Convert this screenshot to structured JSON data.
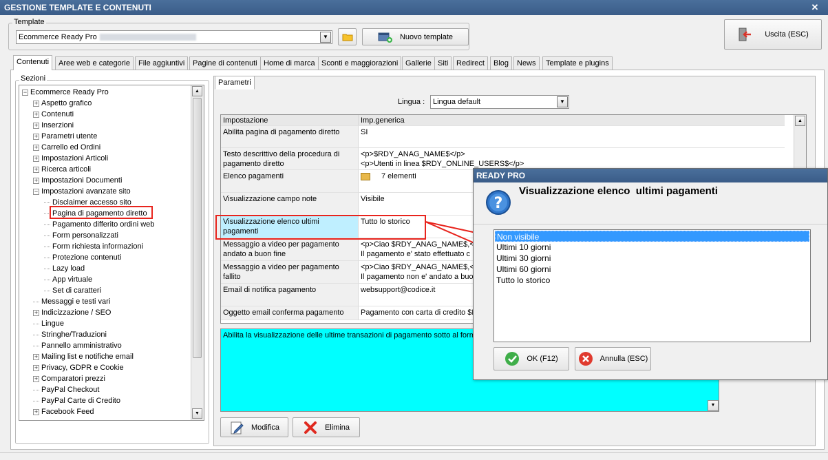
{
  "window": {
    "title": "GESTIONE TEMPLATE E CONTENUTI",
    "close": "✕"
  },
  "template": {
    "group_label": "Template",
    "combo_value": "Ecommerce Ready Pro",
    "new_button": "Nuovo template"
  },
  "exit_button": "Uscita (ESC)",
  "tabs": [
    "Contenuti",
    "Aree web e categorie",
    "File aggiuntivi",
    "Pagine di contenuti",
    "Home di marca",
    "Sconti e maggiorazioni",
    "Gallerie",
    "Siti",
    "Redirect",
    "Blog",
    "News",
    "Template e plugins"
  ],
  "sections": {
    "label": "Sezioni",
    "root": "Ecommerce Ready Pro",
    "items": [
      {
        "label": "Aspetto grafico",
        "exp": "+"
      },
      {
        "label": "Contenuti",
        "exp": "+"
      },
      {
        "label": "Inserzioni",
        "exp": "+"
      },
      {
        "label": "Parametri utente",
        "exp": "+"
      },
      {
        "label": "Carrello ed Ordini",
        "exp": "+"
      },
      {
        "label": "Impostazioni Articoli",
        "exp": "+"
      },
      {
        "label": "Ricerca articoli",
        "exp": "+"
      },
      {
        "label": "Impostazioni Documenti",
        "exp": "+"
      },
      {
        "label": "Impostazioni avanzate sito",
        "exp": "−"
      },
      {
        "label": "Disclaimer accesso sito",
        "exp": "",
        "child": true
      },
      {
        "label": "Pagina di pagamento diretto",
        "exp": "",
        "child": true,
        "selected": true
      },
      {
        "label": "Pagamento differito ordini web",
        "exp": "",
        "child": true
      },
      {
        "label": "Form personalizzati",
        "exp": "",
        "child": true
      },
      {
        "label": "Form richiesta informazioni",
        "exp": "",
        "child": true
      },
      {
        "label": "Protezione contenuti",
        "exp": "",
        "child": true
      },
      {
        "label": "Lazy load",
        "exp": "",
        "child": true
      },
      {
        "label": "App virtuale",
        "exp": "",
        "child": true
      },
      {
        "label": "Set di caratteri",
        "exp": "",
        "child": true
      },
      {
        "label": "Messaggi e testi vari",
        "exp": ""
      },
      {
        "label": "Indicizzazione / SEO",
        "exp": "+"
      },
      {
        "label": "Lingue",
        "exp": ""
      },
      {
        "label": "Stringhe/Traduzioni",
        "exp": ""
      },
      {
        "label": "Pannello amministrativo",
        "exp": ""
      },
      {
        "label": "Mailing list e notifiche email",
        "exp": "+"
      },
      {
        "label": "Privacy, GDPR e Cookie",
        "exp": "+"
      },
      {
        "label": "Comparatori prezzi",
        "exp": "+"
      },
      {
        "label": "PayPal Checkout",
        "exp": ""
      },
      {
        "label": "PayPal Carte di Credito",
        "exp": ""
      },
      {
        "label": "Facebook Feed",
        "exp": "+"
      }
    ]
  },
  "params": {
    "tab": "Parametri",
    "lingua_label": "Lingua :",
    "lingua_value": "Lingua default",
    "header": [
      "Impostazione",
      "Imp.generica"
    ],
    "rows": [
      {
        "key": "Abilita pagina di pagamento diretto",
        "val": "SI"
      },
      {
        "key": "Testo descrittivo della procedura di pagamento diretto",
        "val": "<p>$RDY_ANAG_NAME$</p>\n<p>Utenti in linea $RDY_ONLINE_USERS$</p>"
      },
      {
        "key": "Elenco pagamenti",
        "val": "7 elementi"
      },
      {
        "key": "Visualizzazione campo note",
        "val": "Visibile"
      },
      {
        "key": "Visualizzazione elenco  ultimi pagamenti",
        "val": "Tutto lo storico"
      },
      {
        "key": "Messaggio a video per pagamento andato a buon fine",
        "val": "<p>Ciao $RDY_ANAG_NAME$,<b\nIl pagamento e' stato effettuato c"
      },
      {
        "key": "Messaggio a video per pagamento fallito",
        "val": "<p>Ciao $RDY_ANAG_NAME$,<b\nIl pagamento non e' andato a buo"
      },
      {
        "key": "Email di notifica pagamento",
        "val": "websupport@codice.it"
      },
      {
        "key": "Oggetto email conferma pagamento",
        "val": "Pagamento con carta di credito $R"
      }
    ],
    "description": "Abilita la visualizzazione delle ultime transazioni di pagamento sotto al form di",
    "modify_button": "Modifica",
    "delete_button": "Elimina"
  },
  "dialog": {
    "title": "READY PRO",
    "question": "Visualizzazione elenco  ultimi pagamenti",
    "options": [
      "Non visibile",
      "Ultimi 10 giorni",
      "Ultimi 30 giorni",
      "Ultimi 60 giorni",
      "Tutto lo storico"
    ],
    "selected_index": 0,
    "ok_button": "OK (F12)",
    "cancel_button": "Annulla (ESC)"
  },
  "colors": {
    "accent": "#3a5c88",
    "highlight": "#e8241d",
    "description_bg": "#00ffff",
    "selection": "#3399ff"
  }
}
